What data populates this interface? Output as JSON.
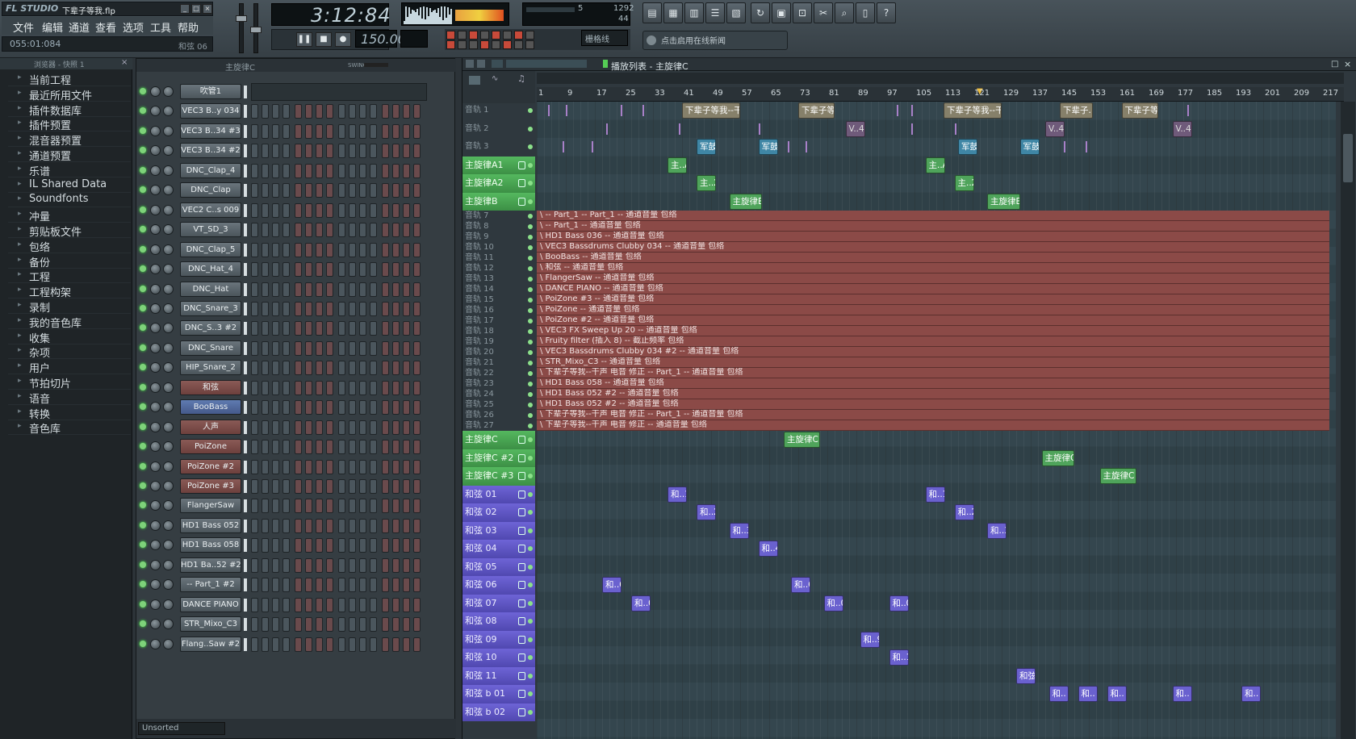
{
  "app": {
    "logo": "FL STUDIO",
    "file": "下辈子等我.flp"
  },
  "menu": [
    "文件",
    "编辑",
    "通道",
    "查看",
    "选项",
    "工具",
    "帮助"
  ],
  "status": {
    "song_pos": "055:01:084",
    "hint": "和弦 06"
  },
  "transport": {
    "time": "3:12:84",
    "tempo": "150.000"
  },
  "cpu": {
    "a": "5",
    "b": "1292",
    "c": "44"
  },
  "snap": {
    "label": "栅格线"
  },
  "news": {
    "text": "点击启用在线新闻"
  },
  "toolbar_icons": [
    "mixer-icon",
    "channel-rack-icon",
    "piano-roll-icon",
    "playlist-icon",
    "browser-icon",
    "undo-icon",
    "save-icon",
    "render-icon",
    "tools-icon",
    "search-icon",
    "info-icon",
    "help-icon"
  ],
  "browser": {
    "title": "浏览器 - 快照 1",
    "items": [
      "当前工程",
      "最近所用文件",
      "插件数据库",
      "插件预置",
      "混音器预置",
      "通道预置",
      "乐谱",
      "IL Shared Data",
      "Soundfonts",
      "冲量",
      "剪贴板文件",
      "包络",
      "备份",
      "工程",
      "工程构架",
      "录制",
      "我的音色库",
      "收集",
      "杂项",
      "用户",
      "节拍切片",
      "语音",
      "转换",
      "音色库"
    ]
  },
  "rack": {
    "title": "主旋律C",
    "swing": "SWING",
    "footer": "Unsorted",
    "channels": [
      {
        "name": "吹管1",
        "style": "normal"
      },
      {
        "name": "VEC3 B..y 034",
        "style": "normal"
      },
      {
        "name": "VEC3 B..34 #3",
        "style": "normal"
      },
      {
        "name": "VEC3 B..34 #2",
        "style": "normal"
      },
      {
        "name": "DNC_Clap_4",
        "style": "normal"
      },
      {
        "name": "DNC_Clap",
        "style": "normal"
      },
      {
        "name": "VEC2 C..s 009",
        "style": "normal"
      },
      {
        "name": "VT_SD_3",
        "style": "normal"
      },
      {
        "name": "DNC_Clap_5",
        "style": "normal"
      },
      {
        "name": "DNC_Hat_4",
        "style": "normal"
      },
      {
        "name": "DNC_Hat",
        "style": "normal"
      },
      {
        "name": "DNC_Snare_3",
        "style": "normal"
      },
      {
        "name": "DNC_S..3 #2",
        "style": "normal"
      },
      {
        "name": "DNC_Snare",
        "style": "normal"
      },
      {
        "name": "HIP_Snare_2",
        "style": "normal"
      },
      {
        "name": "和弦",
        "style": "red"
      },
      {
        "name": "BooBass",
        "style": "blue"
      },
      {
        "name": "人声",
        "style": "red"
      },
      {
        "name": "PoiZone",
        "style": "red"
      },
      {
        "name": "PoiZone #2",
        "style": "red"
      },
      {
        "name": "PoiZone #3",
        "style": "red"
      },
      {
        "name": "FlangerSaw",
        "style": "normal"
      },
      {
        "name": "HD1 Bass 052",
        "style": "normal"
      },
      {
        "name": "HD1 Bass 058",
        "style": "normal"
      },
      {
        "name": "HD1 Ba..52 #2",
        "style": "normal"
      },
      {
        "name": "-- Part_1 #2",
        "style": "normal"
      },
      {
        "name": "DANCE PIANO",
        "style": "normal"
      },
      {
        "name": "STR_Mixo_C3",
        "style": "normal"
      },
      {
        "name": "Flang..Saw #2",
        "style": "normal"
      }
    ]
  },
  "playlist": {
    "title": "播放列表 - 主旋律C",
    "bars": [
      "1",
      "9",
      "17",
      "25",
      "33",
      "41",
      "49",
      "57",
      "65",
      "73",
      "81",
      "89",
      "97",
      "105",
      "113",
      "121",
      "129",
      "137",
      "145",
      "153",
      "161",
      "169",
      "177",
      "185",
      "193",
      "201",
      "209",
      "217"
    ],
    "top_tracks": [
      {
        "name": "音轨 1",
        "style": "plain"
      },
      {
        "name": "音轨 2",
        "style": "plain"
      },
      {
        "name": "音轨 3",
        "style": "plain"
      },
      {
        "name": "主旋律A1",
        "style": "green"
      },
      {
        "name": "主旋律A2",
        "style": "green"
      },
      {
        "name": "主旋律B",
        "style": "green"
      }
    ],
    "auto_tracks": [
      {
        "track": "音轨 7",
        "label": "\\ -- Part_1 -- Part_1 -- 通道音量 包络"
      },
      {
        "track": "音轨 8",
        "label": "\\ -- Part_1 -- 通道音量 包络"
      },
      {
        "track": "音轨 9",
        "label": "\\ HD1 Bass 036 -- 通道音量 包络"
      },
      {
        "track": "音轨 10",
        "label": "\\ VEC3 Bassdrums Clubby 034 -- 通道音量 包络"
      },
      {
        "track": "音轨 11",
        "label": "\\ BooBass -- 通道音量 包络"
      },
      {
        "track": "音轨 12",
        "label": "\\ 和弦 -- 通道音量 包络"
      },
      {
        "track": "音轨 13",
        "label": "\\ FlangerSaw -- 通道音量 包络"
      },
      {
        "track": "音轨 14",
        "label": "\\ DANCE PIANO -- 通道音量 包络"
      },
      {
        "track": "音轨 15",
        "label": "\\ PoiZone #3 -- 通道音量 包络"
      },
      {
        "track": "音轨 16",
        "label": "\\ PoiZone -- 通道音量 包络"
      },
      {
        "track": "音轨 17",
        "label": "\\ PoiZone #2 -- 通道音量 包络"
      },
      {
        "track": "音轨 18",
        "label": "\\ VEC3 FX Sweep Up 20 -- 通道音量 包络"
      },
      {
        "track": "音轨 19",
        "label": "\\ Fruity filter (插入 8) -- 截止频率 包络"
      },
      {
        "track": "音轨 20",
        "label": "\\ VEC3 Bassdrums Clubby 034 #2 -- 通道音量 包络"
      },
      {
        "track": "音轨 21",
        "label": "\\ STR_Mixo_C3 -- 通道音量 包络"
      },
      {
        "track": "音轨 22",
        "label": "\\ 下辈子等我--干声 电音 修正 -- Part_1 -- 通道音量 包络"
      },
      {
        "track": "音轨 23",
        "label": "\\ HD1 Bass 058 -- 通道音量 包络"
      },
      {
        "track": "音轨 24",
        "label": "\\ HD1 Bass 052 #2 -- 通道音量 包络"
      },
      {
        "track": "音轨 25",
        "label": "\\ HD1 Bass 052 #2 -- 通道音量 包络"
      },
      {
        "track": "音轨 26",
        "label": "\\ 下辈子等我--干声 电音 修正 -- Part_1 -- 通道音量 包络"
      },
      {
        "track": "音轨 27",
        "label": "\\ 下辈子等我--干声 电音 修正 -- 通道音量 包络"
      }
    ],
    "bottom_tracks": [
      {
        "name": "主旋律C",
        "style": "green"
      },
      {
        "name": "主旋律C #2",
        "style": "green"
      },
      {
        "name": "主旋律C #3",
        "style": "green"
      },
      {
        "name": "和弦 01",
        "style": "purple"
      },
      {
        "name": "和弦 02",
        "style": "purple"
      },
      {
        "name": "和弦 03",
        "style": "purple"
      },
      {
        "name": "和弦 04",
        "style": "purple"
      },
      {
        "name": "和弦 05",
        "style": "purple"
      },
      {
        "name": "和弦 06",
        "style": "purple"
      },
      {
        "name": "和弦 07",
        "style": "purple"
      },
      {
        "name": "和弦 08",
        "style": "purple"
      },
      {
        "name": "和弦 09",
        "style": "purple"
      },
      {
        "name": "和弦 10",
        "style": "purple"
      },
      {
        "name": "和弦 11",
        "style": "purple"
      },
      {
        "name": "和弦 b 01",
        "style": "purple"
      },
      {
        "name": "和弦 b 02",
        "style": "purple"
      }
    ],
    "clips": [
      {
        "row": "t0",
        "bar": 41,
        "len": 16,
        "style": "tan",
        "label": "下辈子等我--干..电音 修正"
      },
      {
        "row": "t0",
        "bar": 73,
        "len": 10,
        "style": "tan",
        "label": "下辈子等..正"
      },
      {
        "row": "t0",
        "bar": 113,
        "len": 16,
        "style": "tan",
        "label": "下辈子等我--干声..-- Part_4"
      },
      {
        "row": "t0",
        "bar": 145,
        "len": 9,
        "style": "tan",
        "label": "下辈子..正"
      },
      {
        "row": "t0",
        "bar": 162,
        "len": 10,
        "style": "tan",
        "label": "下辈子等..正"
      },
      {
        "row": "t1",
        "bar": 86,
        "len": 4,
        "style": "pink",
        "label": "V..4"
      },
      {
        "row": "t1",
        "bar": 141,
        "len": 4,
        "style": "pink",
        "label": "V..4"
      },
      {
        "row": "t1",
        "bar": 176,
        "len": 4,
        "style": "pink",
        "label": "V..4"
      },
      {
        "row": "t2",
        "bar": 45,
        "len": 5,
        "style": "teal",
        "label": "军鼓"
      },
      {
        "row": "t2",
        "bar": 62,
        "len": 5,
        "style": "teal",
        "label": "军鼓"
      },
      {
        "row": "t2",
        "bar": 117,
        "len": 5,
        "style": "teal",
        "label": "军鼓"
      },
      {
        "row": "t2",
        "bar": 134,
        "len": 5,
        "style": "teal",
        "label": "军鼓"
      },
      {
        "row": "t3",
        "bar": 37,
        "len": 5,
        "style": "green",
        "label": "主..A1"
      },
      {
        "row": "t3",
        "bar": 108,
        "len": 5,
        "style": "green",
        "label": "主..A1"
      },
      {
        "row": "t4",
        "bar": 45,
        "len": 5,
        "style": "green",
        "label": "主..2"
      },
      {
        "row": "t4",
        "bar": 116,
        "len": 5,
        "style": "green",
        "label": "主..2"
      },
      {
        "row": "t5",
        "bar": 54,
        "len": 9,
        "style": "green",
        "label": "主旋律B"
      },
      {
        "row": "t5",
        "bar": 125,
        "len": 9,
        "style": "green",
        "label": "主旋律B"
      },
      {
        "row": "b0",
        "bar": 69,
        "len": 10,
        "style": "green",
        "label": "主旋律C"
      },
      {
        "row": "b1",
        "bar": 140,
        "len": 9,
        "style": "green",
        "label": "主旋律C #2"
      },
      {
        "row": "b2",
        "bar": 156,
        "len": 10,
        "style": "green",
        "label": "主旋律C #3"
      },
      {
        "row": "b3",
        "bar": 37,
        "len": 4,
        "style": "purple",
        "label": "和..1"
      },
      {
        "row": "b3",
        "bar": 108,
        "len": 4,
        "style": "purple",
        "label": "和..1"
      },
      {
        "row": "b4",
        "bar": 45,
        "len": 5,
        "style": "purple",
        "label": "和..2"
      },
      {
        "row": "b4",
        "bar": 116,
        "len": 5,
        "style": "purple",
        "label": "和..2"
      },
      {
        "row": "b5",
        "bar": 54,
        "len": 4,
        "style": "purple",
        "label": "和..3"
      },
      {
        "row": "b5",
        "bar": 125,
        "len": 4,
        "style": "purple",
        "label": "和..3"
      },
      {
        "row": "b6",
        "bar": 62,
        "len": 5,
        "style": "purple",
        "label": "和..4"
      },
      {
        "row": "b8",
        "bar": 19,
        "len": 4,
        "style": "purple",
        "label": "和..6"
      },
      {
        "row": "b8",
        "bar": 71,
        "len": 4,
        "style": "purple",
        "label": "和..6"
      },
      {
        "row": "b9",
        "bar": 27,
        "len": 5,
        "style": "purple",
        "label": "和..07"
      },
      {
        "row": "b9",
        "bar": 80,
        "len": 5,
        "style": "purple",
        "label": "和..07"
      },
      {
        "row": "b9",
        "bar": 98,
        "len": 5,
        "style": "purple",
        "label": "和..07"
      },
      {
        "row": "b11",
        "bar": 90,
        "len": 4,
        "style": "purple",
        "label": "和..9"
      },
      {
        "row": "b12",
        "bar": 98,
        "len": 5,
        "style": "purple",
        "label": "和..10"
      },
      {
        "row": "b13",
        "bar": 133,
        "len": 5,
        "style": "purple",
        "label": "和弦 11"
      },
      {
        "row": "b14",
        "bar": 142,
        "len": 4,
        "style": "purple",
        "label": "和.."
      },
      {
        "row": "b14",
        "bar": 150,
        "len": 4,
        "style": "purple",
        "label": "和.."
      },
      {
        "row": "b14",
        "bar": 158,
        "len": 4,
        "style": "purple",
        "label": "和.."
      },
      {
        "row": "b14",
        "bar": 176,
        "len": 4,
        "style": "purple",
        "label": "和.."
      },
      {
        "row": "b14",
        "bar": 195,
        "len": 4,
        "style": "purple",
        "label": "和.."
      }
    ]
  }
}
